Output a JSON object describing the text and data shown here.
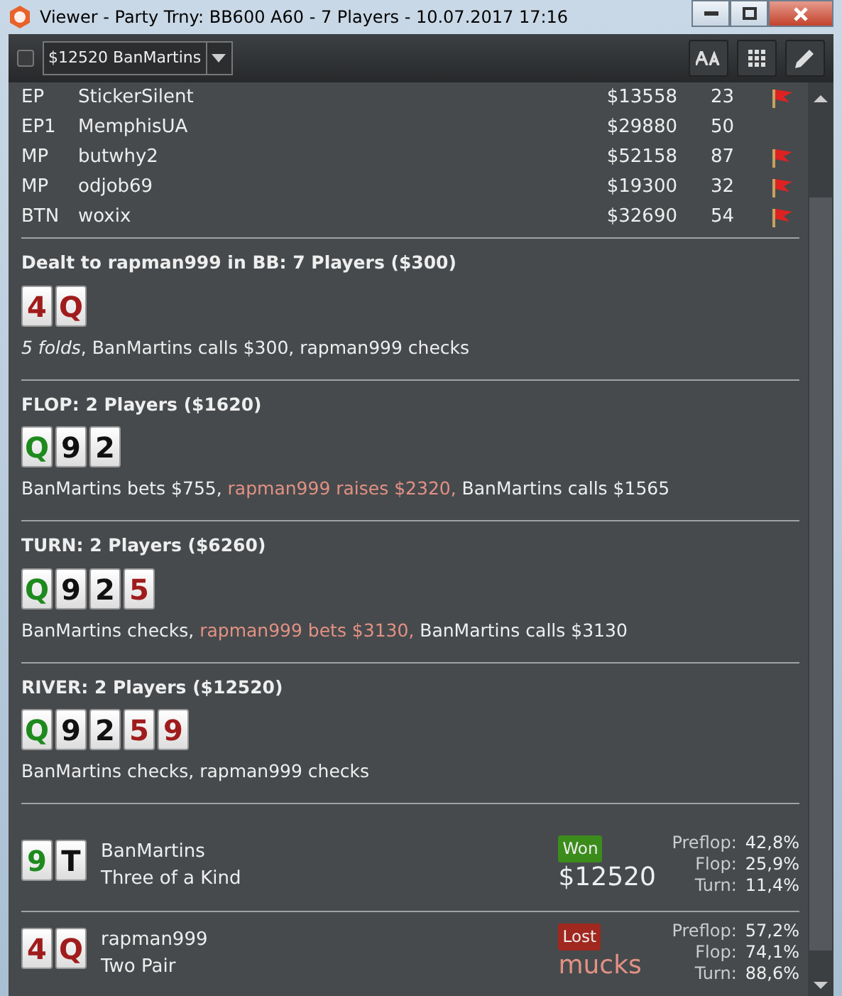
{
  "window": {
    "title": "Viewer - Party Trny: BB600 A60 - 7 Players - 10.07.2017 17:16"
  },
  "toolbar": {
    "checked": false,
    "hand_select": "$12520 BanMartins"
  },
  "players": [
    {
      "position": "EP",
      "name": "StickerSilent",
      "stack": "$13558",
      "hands": "23",
      "flagged": true
    },
    {
      "position": "EP1",
      "name": "MemphisUA",
      "stack": "$29880",
      "hands": "50",
      "flagged": false
    },
    {
      "position": "MP",
      "name": "butwhy2",
      "stack": "$52158",
      "hands": "87",
      "flagged": true
    },
    {
      "position": "MP",
      "name": "odjob69",
      "stack": "$19300",
      "hands": "32",
      "flagged": true
    },
    {
      "position": "BTN",
      "name": "woxix",
      "stack": "$32690",
      "hands": "54",
      "flagged": true
    }
  ],
  "streets": [
    {
      "title": "Dealt to rapman999 in BB: 7 Players ($300)",
      "cards": [
        {
          "rank": "4",
          "color": "#a01c1c"
        },
        {
          "rank": "Q",
          "color": "#a01c1c"
        }
      ],
      "actions": [
        {
          "text": "*5 folds*, BanMartins calls $300, rapman999 checks",
          "highlight": false
        }
      ]
    },
    {
      "title": "FLOP: 2 Players ($1620)",
      "cards": [
        {
          "rank": "Q",
          "color": "#1e8a1e"
        },
        {
          "rank": "9",
          "color": "#111111"
        },
        {
          "rank": "2",
          "color": "#111111"
        }
      ],
      "actions": [
        {
          "text": "BanMartins bets $755, ",
          "highlight": false
        },
        {
          "text": "rapman999 raises $2320,",
          "highlight": true
        },
        {
          "text": " BanMartins calls $1565",
          "highlight": false
        }
      ]
    },
    {
      "title": "TURN: 2 Players ($6260)",
      "cards": [
        {
          "rank": "Q",
          "color": "#1e8a1e"
        },
        {
          "rank": "9",
          "color": "#111111"
        },
        {
          "rank": "2",
          "color": "#111111"
        },
        {
          "rank": "5",
          "color": "#a01c1c"
        }
      ],
      "actions": [
        {
          "text": "BanMartins checks, ",
          "highlight": false
        },
        {
          "text": "rapman999 bets $3130,",
          "highlight": true
        },
        {
          "text": " BanMartins calls $3130",
          "highlight": false
        }
      ]
    },
    {
      "title": "RIVER: 2 Players ($12520)",
      "cards": [
        {
          "rank": "Q",
          "color": "#1e8a1e"
        },
        {
          "rank": "9",
          "color": "#111111"
        },
        {
          "rank": "2",
          "color": "#111111"
        },
        {
          "rank": "5",
          "color": "#a01c1c"
        },
        {
          "rank": "9",
          "color": "#a01c1c"
        }
      ],
      "actions": [
        {
          "text": "BanMartins checks, rapman999 checks",
          "highlight": false
        }
      ]
    }
  ],
  "results": [
    {
      "cards": [
        {
          "rank": "9",
          "color": "#1e8a1e"
        },
        {
          "rank": "T",
          "color": "#111111"
        }
      ],
      "name": "BanMartins",
      "hand": "Three of a Kind",
      "kind": "won",
      "badge": "Won",
      "amount": "$12520",
      "equity": [
        {
          "label": "Preflop:",
          "value": "42,8%"
        },
        {
          "label": "Flop:",
          "value": "25,9%"
        },
        {
          "label": "Turn:",
          "value": "11,4%"
        }
      ]
    },
    {
      "cards": [
        {
          "rank": "4",
          "color": "#a01c1c"
        },
        {
          "rank": "Q",
          "color": "#a01c1c"
        }
      ],
      "name": "rapman999",
      "hand": "Two Pair",
      "kind": "lost",
      "badge": "Lost",
      "amount": "mucks",
      "equity": [
        {
          "label": "Preflop:",
          "value": "57,2%"
        },
        {
          "label": "Flop:",
          "value": "74,1%"
        },
        {
          "label": "Turn:",
          "value": "88,6%"
        }
      ]
    }
  ]
}
